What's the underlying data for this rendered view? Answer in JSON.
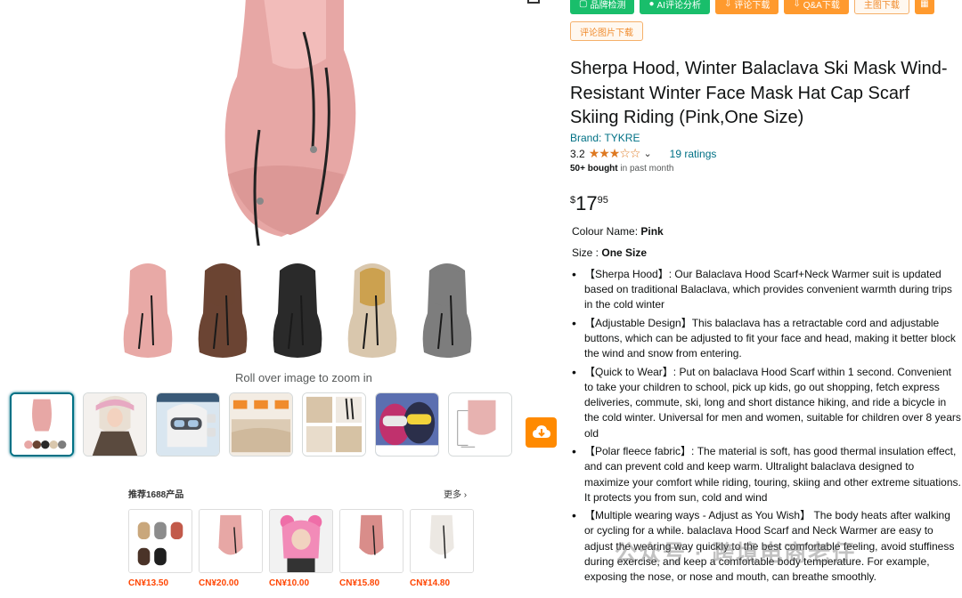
{
  "toolbar": {
    "brand_check": "品牌检测",
    "ai_review": "AI评论分析",
    "review_download": "评论下载",
    "qa_download": "Q&A下载",
    "main_image_download": "主图下载",
    "review_images_download": "评论图片下载"
  },
  "product": {
    "title": "Sherpa Hood, Winter Balaclava Ski Mask Wind-Resistant Winter Face Mask Hat Cap Scarf Skiing Riding (Pink,One Size)",
    "brand": "Brand: TYKRE",
    "rating_value": "3.2",
    "stars": "★★★☆☆",
    "ratings_count": "19 ratings",
    "bought_bold": "50+ bought",
    "bought_rest": " in past month",
    "price_currency": "$",
    "price_whole": "17",
    "price_fraction": "95",
    "colour_label": "Colour Name: ",
    "colour_value": "Pink",
    "size_label": "Size : ",
    "size_value": "One Size",
    "bullets": [
      "【Sherpa Hood】: Our Balaclava Hood Scarf+Neck Warmer suit is updated based on traditional Balaclava, which provides convenient warmth during trips in the cold winter",
      "【Adjustable Design】This balaclava has a retractable cord and adjustable buttons, which can be adjusted to fit your face and head, making it better block the wind and snow from entering.",
      "【Quick to Wear】: Put on balaclava Hood Scarf within 1 second. Convenient to take your children to school, pick up kids, go out shopping, fetch express deliveries, commute, ski, long and short distance hiking, and ride a bicycle in the cold winter. Universal for men and women, suitable for children over 8 years old",
      "【Polar fleece fabric】: The material is soft, has good thermal insulation effect, and can prevent cold and keep warm. Ultralight balaclava designed to maximize your comfort while riding, touring, skiing and other extreme situations. It protects you from sun, cold and wind",
      "【Multiple wearing ways - Adjust as You Wish】 The body heats after walking or cycling for a while. balaclava Hood Scarf and Neck Warmer are easy to adjust the wearing way quickly to the best comfortable feeling, avoid stuffiness during exercise, and keep a comfortable body temperature. For example, exposing the nose, or nose and mouth, can breathe smoothly."
    ]
  },
  "gallery": {
    "zoom_hint": "Roll over image to zoom in",
    "variant_colors": [
      "#e8a9a6",
      "#6b4433",
      "#2a2a2a",
      "#d9c7ad",
      "#7d7d7d"
    ],
    "variant_accents": [
      "#e8a9a6",
      "#6b4433",
      "#2a2a2a",
      "#c99a3e",
      "#7d7d7d"
    ]
  },
  "recommend": {
    "title": "推荐1688产品",
    "more": "更多",
    "prices": [
      "CN¥13.50",
      "CN¥20.00",
      "CN¥10.00",
      "CN¥15.80",
      "CN¥14.80"
    ]
  },
  "watermark": "公众号 · 跨境电商老仔"
}
